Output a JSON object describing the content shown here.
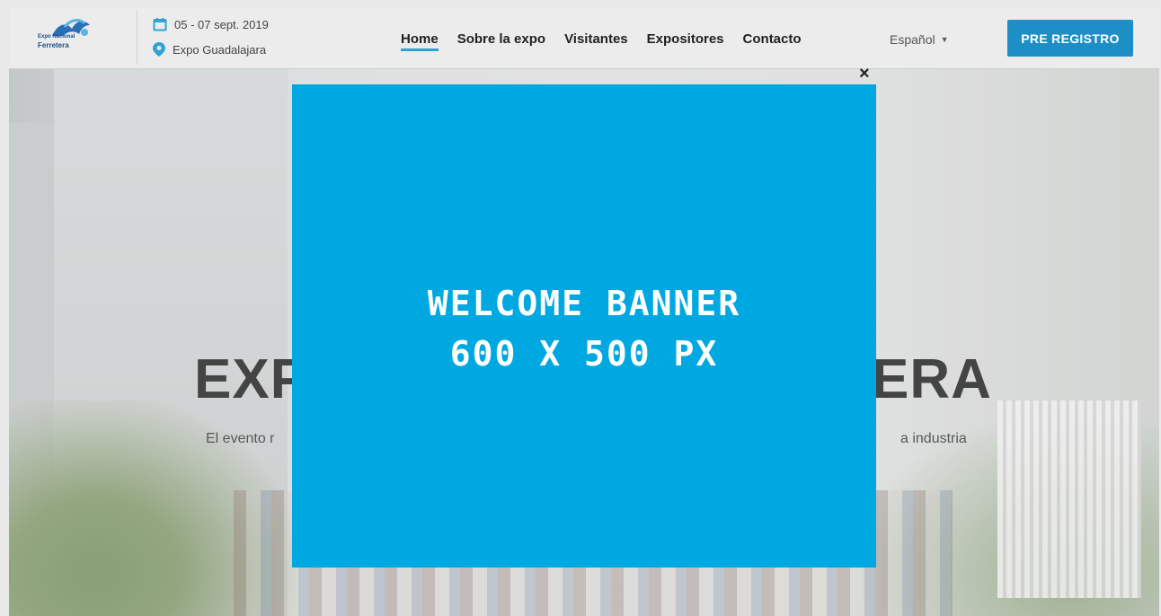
{
  "header": {
    "logo": {
      "line1": "Expo",
      "line2": "Nacional",
      "line3": "Ferretera"
    },
    "date": "05 - 07 sept. 2019",
    "venue": "Expo Guadalajara",
    "nav": [
      {
        "label": "Home",
        "active": true
      },
      {
        "label": "Sobre la expo"
      },
      {
        "label": "Visitantes"
      },
      {
        "label": "Expositores"
      },
      {
        "label": "Contacto"
      }
    ],
    "language": "Español",
    "cta": "PRE REGISTRO",
    "colors": {
      "accent": "#1d8fc6",
      "logo": "#1b4f8a"
    }
  },
  "hero": {
    "title_left": "EXP",
    "title_right": "ERA",
    "subtitle_left": "El evento r",
    "subtitle_right": "a industria"
  },
  "modal": {
    "line1": "WELCOME BANNER",
    "line2": "600 X 500 PX",
    "close": "×",
    "color": "#00a8e1"
  }
}
